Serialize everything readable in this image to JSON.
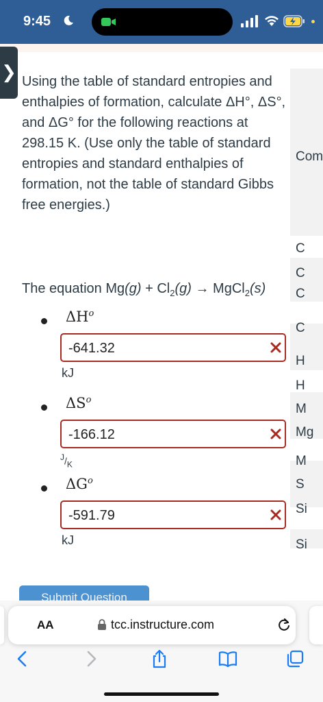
{
  "status_bar": {
    "time": "9:45"
  },
  "question": {
    "text": "Using the table of standard entropies and enthalpies of formation, calculate ΔH°, ΔS°, and ΔG° for the following reactions at 298.15 K. (Use only the table of standard entropies and standard enthalpies of formation, not the table of standard Gibbs free energies.)",
    "equation": {
      "prefix": "The equation Mg",
      "state1": "(g)",
      "plus": " + Cl",
      "sub2": "2",
      "state2": "(g)",
      "arrow": " → MgCl",
      "sub3": "2",
      "state3": "(s)"
    }
  },
  "answers": [
    {
      "label": "ΔH",
      "sup": "o",
      "value": "-641.32",
      "unit": "kJ",
      "status": "incorrect"
    },
    {
      "label": "ΔS",
      "sup": "o",
      "value": "-166.12",
      "unit_num": "J",
      "unit_den": "K",
      "status": "incorrect"
    },
    {
      "label": "ΔG",
      "sup": "o",
      "value": "-591.79",
      "unit": "kJ",
      "status": "incorrect"
    }
  ],
  "submit_button": {
    "label": "Submit Question"
  },
  "side_table": {
    "header": "Com",
    "rows": [
      "C",
      "C",
      "C",
      "C",
      "H",
      "H",
      "M",
      "Mg",
      "M",
      "S",
      "Si",
      "Si"
    ]
  },
  "browser": {
    "text_size_label": "AA",
    "url": "tcc.instructure.com"
  },
  "colors": {
    "status_bar": "#2f5d95",
    "error": "#a82b22",
    "accent": "#2f7fc8",
    "ios_blue": "#1a7cf5"
  },
  "icons": [
    "moon-icon",
    "signal-icon",
    "wifi-icon",
    "battery-charging-icon",
    "close-x-icon",
    "lock-icon",
    "reload-icon",
    "back-arrow-icon",
    "forward-arrow-icon",
    "share-icon",
    "bookmarks-icon",
    "tabs-icon"
  ]
}
